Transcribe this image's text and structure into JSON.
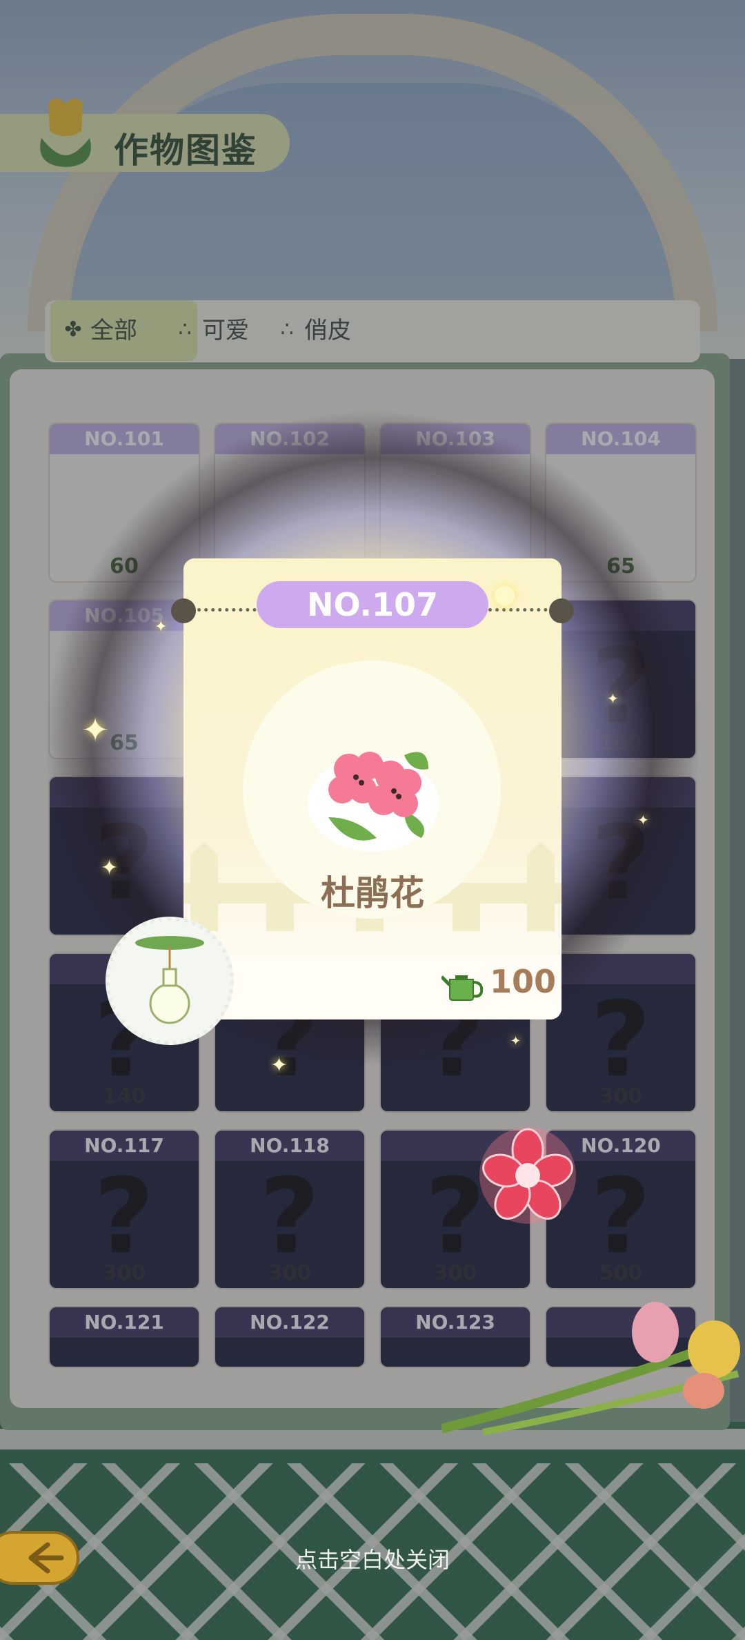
{
  "header": {
    "title": "作物图鉴"
  },
  "tabs": [
    {
      "label": "全部",
      "icon": "clover-icon"
    },
    {
      "label": "可爱",
      "icon": "seeds-icon"
    },
    {
      "label": "俏皮",
      "icon": "seeds-icon"
    }
  ],
  "grid": [
    {
      "no": "NO.101",
      "price": "60",
      "state": "unlocked"
    },
    {
      "no": "NO.102",
      "price": "",
      "state": "unlocked"
    },
    {
      "no": "NO.103",
      "price": "",
      "state": "unlocked"
    },
    {
      "no": "NO.104",
      "price": "65",
      "state": "unlocked"
    },
    {
      "no": "NO.105",
      "price": "65",
      "state": "unlocked"
    },
    {
      "no": "",
      "price": "",
      "state": "locked"
    },
    {
      "no": "",
      "price": "",
      "state": "locked"
    },
    {
      "no": "",
      "price": "100",
      "state": "locked"
    },
    {
      "no": "",
      "price": "",
      "state": "locked"
    },
    {
      "no": "",
      "price": "",
      "state": "locked"
    },
    {
      "no": "",
      "price": "",
      "state": "locked"
    },
    {
      "no": "",
      "price": "",
      "state": "locked"
    },
    {
      "no": "",
      "price": "140",
      "state": "locked"
    },
    {
      "no": "",
      "price": "",
      "state": "locked"
    },
    {
      "no": "",
      "price": "",
      "state": "locked"
    },
    {
      "no": "",
      "price": "300",
      "state": "locked"
    },
    {
      "no": "NO.117",
      "price": "300",
      "state": "locked"
    },
    {
      "no": "NO.118",
      "price": "300",
      "state": "locked"
    },
    {
      "no": "",
      "price": "300",
      "state": "locked"
    },
    {
      "no": "NO.120",
      "price": "500",
      "state": "locked"
    },
    {
      "no": "NO.121",
      "price": "",
      "state": "locked"
    },
    {
      "no": "NO.122",
      "price": "",
      "state": "locked"
    },
    {
      "no": "NO.123",
      "price": "",
      "state": "locked"
    },
    {
      "no": "",
      "price": "",
      "state": "locked"
    }
  ],
  "popup": {
    "number": "NO.107",
    "name": "杜鹃花",
    "price": "100"
  },
  "footer": {
    "close_hint": "点击空白处关闭"
  },
  "colors": {
    "badge": "#cda9ee",
    "title_green": "#3d5a3a",
    "price_brown": "#a67c5a"
  }
}
